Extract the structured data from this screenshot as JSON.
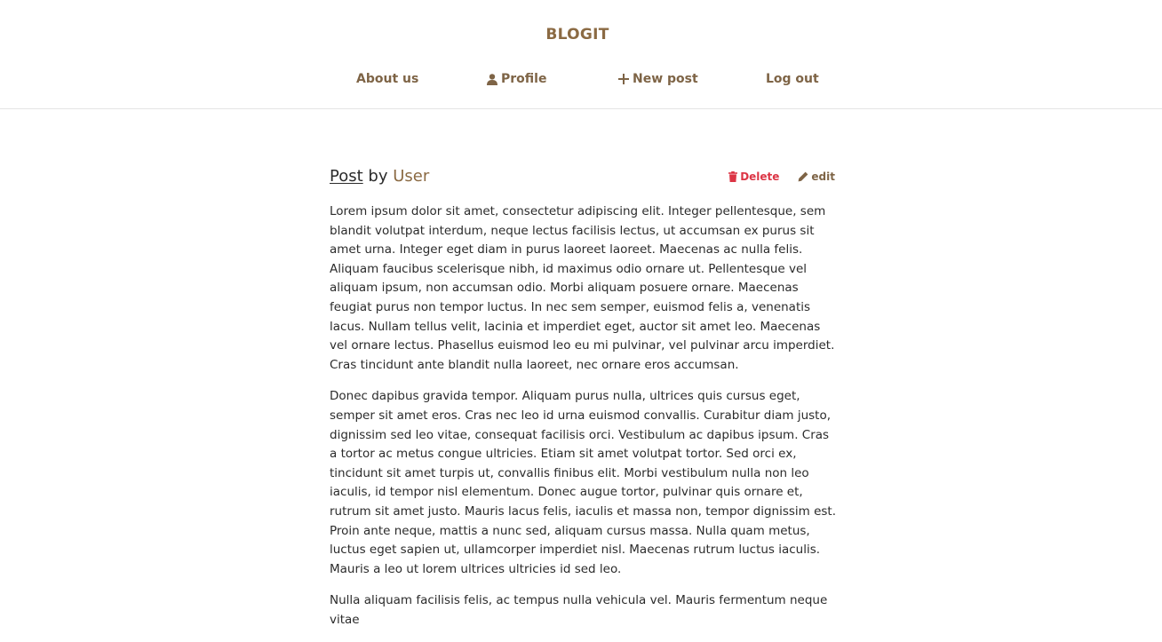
{
  "header": {
    "brand": "BLOGIT",
    "nav": [
      {
        "label": "About us",
        "icon": ""
      },
      {
        "label": "Profile",
        "icon": "user-icon"
      },
      {
        "label": "New post",
        "icon": "plus-icon"
      },
      {
        "label": "Log out",
        "icon": ""
      }
    ]
  },
  "post": {
    "title": "Post",
    "by": "by",
    "author": "User",
    "actions": {
      "delete_label": "Delete",
      "delete_icon": "trash-icon",
      "edit_label": "edit",
      "edit_icon": "pencil-icon"
    },
    "paragraphs": [
      "Lorem ipsum dolor sit amet, consectetur adipiscing elit. Integer pellentesque, sem blandit volutpat interdum, neque lectus facilisis lectus, ut accumsan ex purus sit amet urna. Integer eget diam in purus laoreet laoreet. Maecenas ac nulla felis. Aliquam faucibus scelerisque nibh, id maximus odio ornare ut. Pellentesque vel aliquam ipsum, non accumsan odio. Morbi aliquam posuere ornare. Maecenas feugiat purus non tempor luctus. In nec sem semper, euismod felis a, venenatis lacus. Nullam tellus velit, lacinia et imperdiet eget, auctor sit amet leo. Maecenas vel ornare lectus. Phasellus euismod leo eu mi pulvinar, vel pulvinar arcu imperdiet. Cras tincidunt ante blandit nulla laoreet, nec ornare eros accumsan.",
      "Donec dapibus gravida tempor. Aliquam purus nulla, ultrices quis cursus eget, semper sit amet eros. Cras nec leo id urna euismod convallis. Curabitur diam justo, dignissim sed leo vitae, consequat facilisis orci. Vestibulum ac dapibus ipsum. Cras a tortor ac metus congue ultricies. Etiam sit amet volutpat tortor. Sed orci ex, tincidunt sit amet turpis ut, convallis finibus elit. Morbi vestibulum nulla non leo iaculis, id tempor nisl elementum. Donec augue tortor, pulvinar quis ornare et, rutrum sit amet justo. Mauris lacus felis, iaculis et massa non, tempor dignissim est. Proin ante neque, mattis a nunc sed, aliquam cursus massa. Nulla quam metus, luctus eget sapien ut, ullamcorper imperdiet nisl. Maecenas rutrum luctus iaculis. Mauris a leo ut lorem ultrices ultricies id sed leo.",
      "Nulla aliquam facilisis felis, ac tempus nulla vehicula vel. Mauris fermentum neque vitae"
    ]
  },
  "colors": {
    "brand": "#8b6a43",
    "nav_link": "#7e6446",
    "delete": "#dc3545",
    "text": "#2b2b2b",
    "divider": "#e4e4e4"
  }
}
